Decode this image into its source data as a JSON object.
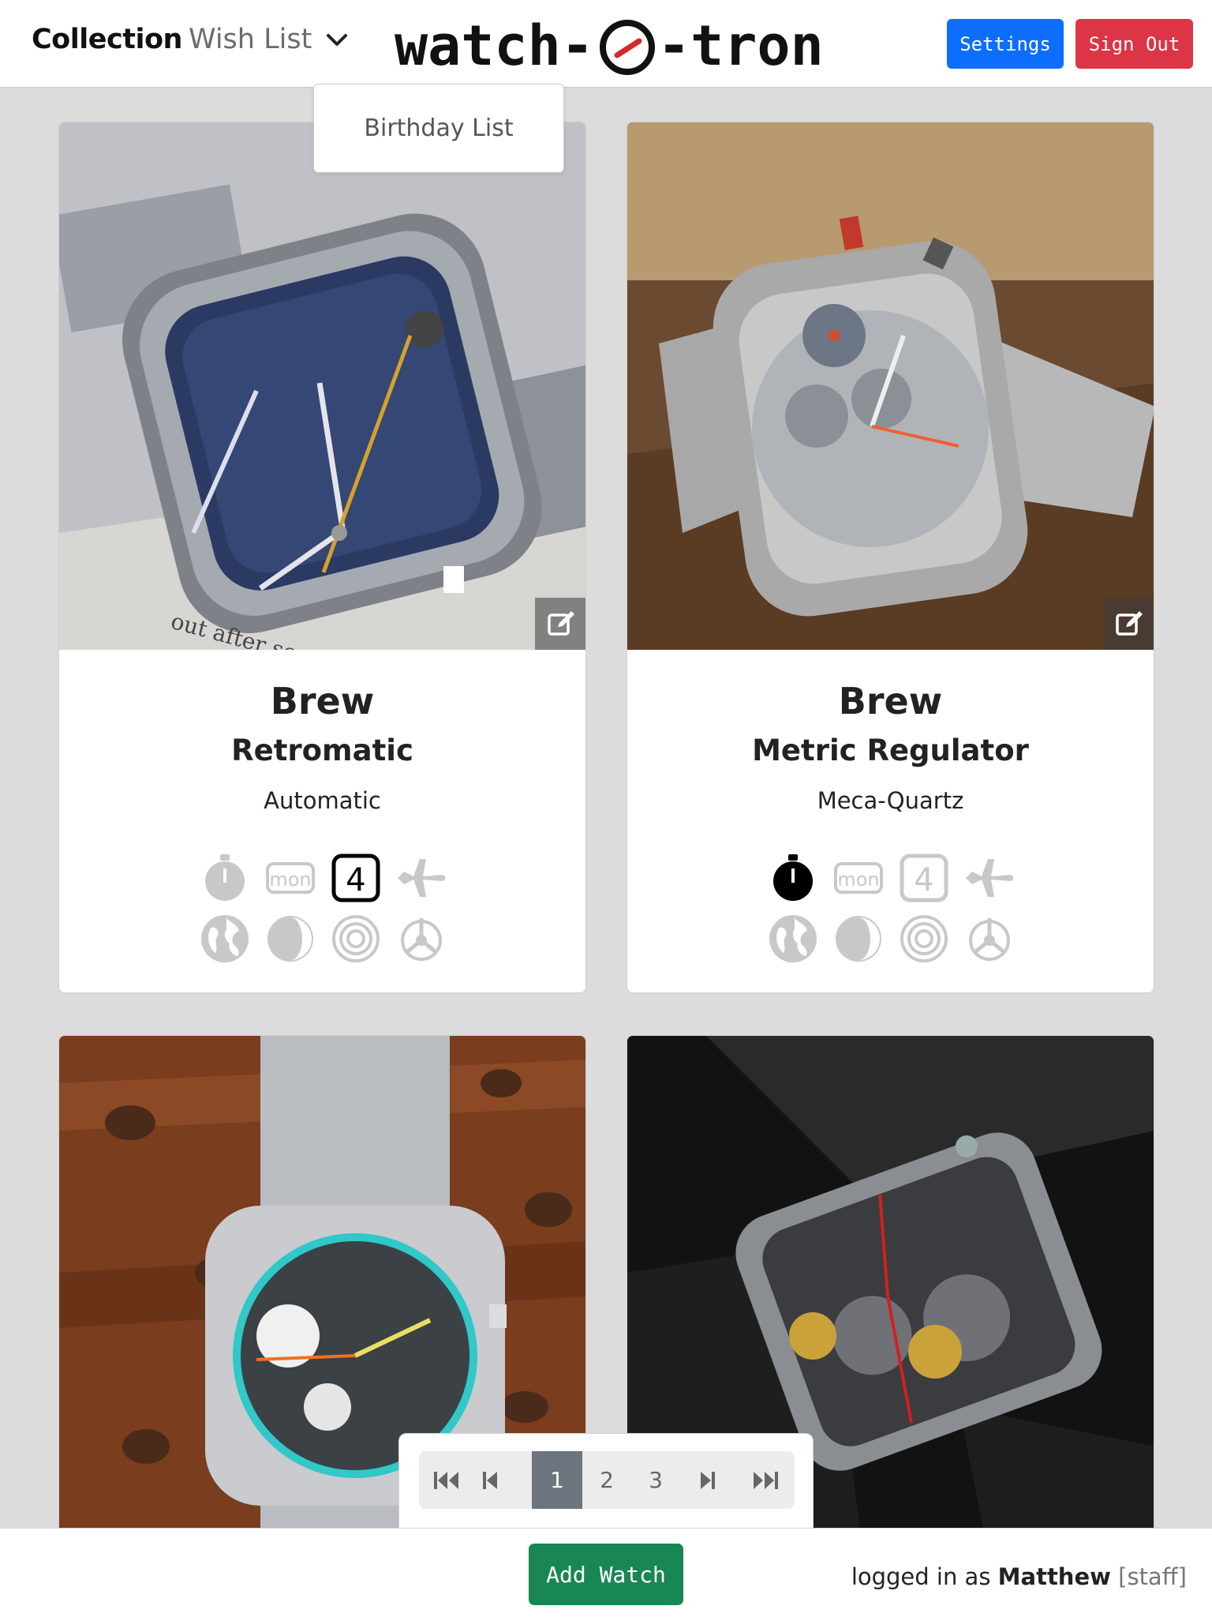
{
  "nav": {
    "collection_label": "Collection",
    "wishlist_label": "Wish List",
    "logo_text_left": "watch-",
    "logo_text_right": "-tron",
    "settings_label": "Settings",
    "signout_label": "Sign Out",
    "dropdown_items": [
      "Birthday List"
    ]
  },
  "colors": {
    "settings": "#0d6efd",
    "signout": "#dc3545",
    "add_watch": "#198754",
    "logo_hand": "#d42a2a",
    "feature_active": "#000000",
    "feature_inactive": "#c8c8c8"
  },
  "watches": [
    {
      "make": "Brew",
      "model": "Retromatic",
      "movement": "Automatic",
      "features": {
        "chronograph": false,
        "day": false,
        "date": true,
        "gmt": false,
        "world_time": false,
        "moon_phase": false,
        "hairspring": false,
        "tourbillon": false
      }
    },
    {
      "make": "Brew",
      "model": "Metric Regulator",
      "movement": "Meca-Quartz",
      "features": {
        "chronograph": true,
        "day": false,
        "date": false,
        "gmt": false,
        "world_time": false,
        "moon_phase": false,
        "hairspring": false,
        "tourbillon": false
      }
    },
    {
      "make": "",
      "model": "",
      "movement": ""
    },
    {
      "make": "",
      "model": "",
      "movement": ""
    }
  ],
  "feature_icons": {
    "day_text": "mon",
    "date_text": "4"
  },
  "pagination": {
    "first_icon": "skip-first-icon",
    "prev_icon": "skip-prev-icon",
    "pages": [
      "1",
      "2",
      "3"
    ],
    "current_page": "1",
    "next_icon": "skip-next-icon",
    "last_icon": "skip-last-icon"
  },
  "footer": {
    "add_watch_label": "Add Watch",
    "logged_in_prefix": "logged in as ",
    "username": "Matthew",
    "role": "[staff]"
  }
}
